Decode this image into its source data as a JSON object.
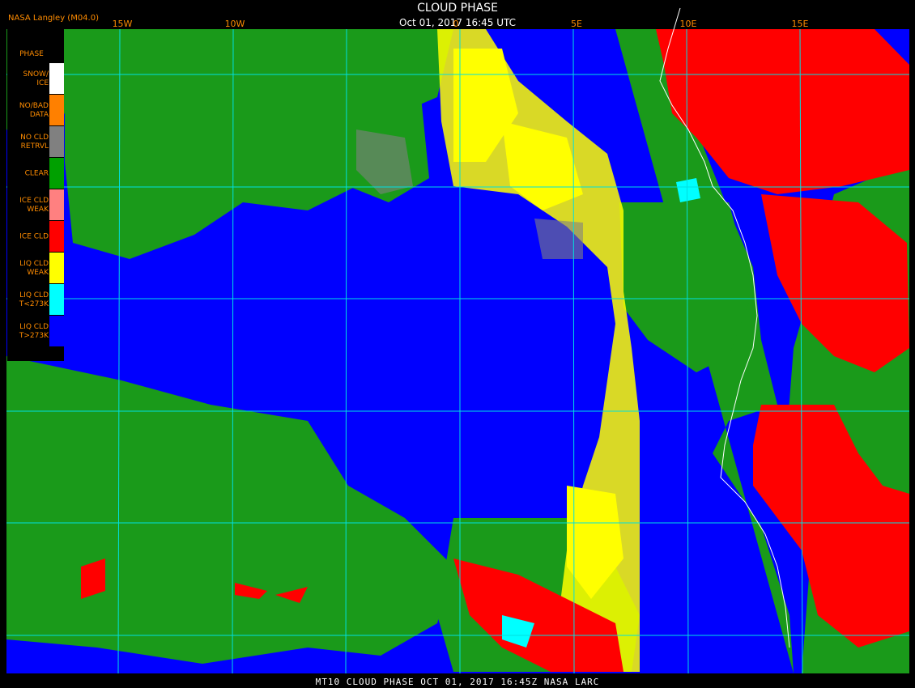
{
  "header": {
    "agency": "NASA Langley (M04.0)",
    "title": "CLOUD PHASE",
    "subtitle": "Oct 01, 2017 16:45 UTC"
  },
  "lon_labels": [
    "15W",
    "10W",
    "0",
    "5E",
    "10E",
    "15E"
  ],
  "legend": {
    "title": "PHASE",
    "items": [
      {
        "label": "SNOW/\nICE",
        "color": "#ffffff"
      },
      {
        "label": "NO/BAD\nDATA",
        "color": "#ff8000"
      },
      {
        "label": "NO CLD\nRETRVL",
        "color": "#808080"
      },
      {
        "label": "CLEAR",
        "color": "#00a000"
      },
      {
        "label": "ICE CLD\nWEAK",
        "color": "#ff8080"
      },
      {
        "label": "ICE CLD",
        "color": "#ff0000"
      },
      {
        "label": "LIQ CLD\nWEAK",
        "color": "#ffff00"
      },
      {
        "label": "LIQ CLD\nT<273K",
        "color": "#00ffff"
      },
      {
        "label": "LIQ CLD\nT>273K",
        "color": "#0000ff"
      }
    ]
  },
  "footer": "MT10  CLOUD PHASE   OCT 01, 2017 16:45Z   NASA LARC",
  "colors": {
    "ocean_liq_warm": "#0000ff",
    "clear": "#1a9a1a",
    "ice": "#ff0000",
    "liq_weak": "#ffff00",
    "liq_cold": "#00ffff",
    "gridlines": "#00e0e0",
    "coastline": "#ffffff",
    "label": "#ff8c00"
  }
}
